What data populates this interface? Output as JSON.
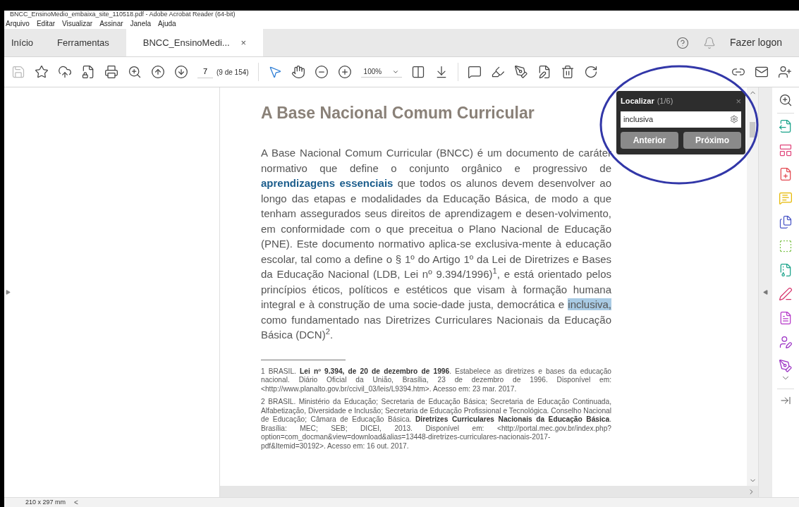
{
  "window": {
    "title": "BNCC_EnsinoMedio_embaixa_site_110518.pdf - Adobe Acrobat Reader (64-bit)"
  },
  "menu": [
    "Arquivo",
    "Editar",
    "Visualizar",
    "Assinar",
    "Janela",
    "Ajuda"
  ],
  "tabs": [
    {
      "label": "Início",
      "selected": false
    },
    {
      "label": "Ferramentas",
      "selected": false
    },
    {
      "label": "BNCC_EnsinoMedi...",
      "selected": true,
      "close": "×"
    }
  ],
  "account": {
    "label": "Fazer logon"
  },
  "toolbar": {
    "save": {
      "disabled": true
    },
    "page": {
      "value": "7",
      "total": "(9 de 154)"
    },
    "tools": [
      {
        "kind": "select",
        "selected": true
      },
      {
        "kind": "hand",
        "selected": false
      }
    ],
    "zoom": {
      "value": "100%"
    }
  },
  "document": {
    "title": "A Base Nacional Comum Curricular",
    "body": [
      {
        "kind": "text",
        "text": "A Base Nacional Comum Curricular (BNCC) é um documento de caráter normativo que define o conjunto orgânico e progressivo de "
      },
      {
        "kind": "strong",
        "text": "aprendizagens essenciais"
      },
      {
        "kind": "text",
        "text": " que todos os alunos devem desenvolver ao longo das etapas e modalidades da Educação Básica, de modo a que tenham assegurados seus direitos de aprendizagem e desen-volvimento, em conformidade com o que preceitua o Plano Nacional de Educação (PNE). Este documento normativo aplica-se exclusiva-mente à educação escolar, tal como a define o § 1º do Artigo 1º da Lei de Diretrizes e Bases da Educação Nacional (LDB, Lei nº 9.394/1996)$^{1}$, e está orientado pelos princípios éticos, políticos e estéticos que visam à formação humana integral e à construção de uma socie-dade justa, democrática e "
      },
      {
        "kind": "match",
        "text": "inclusiva,"
      },
      {
        "kind": "text",
        "text": " como fundamentado nas Diretrizes Curriculares Nacionais da Educação Básica (DCN)$^{2}$."
      }
    ],
    "footnotes": [
      "1   BRASIL. **Lei nº 9.394, de 20 de dezembro de 1996**. Estabelece as diretrizes e bases da educação nacional. Diário Oficial da União, Brasília, 23 de dezembro de 1996. Disponível em: <http://www.planalto.gov.br/ccivil_03/leis/L9394.htm>. Acesso em: 23 mar. 2017.",
      "2   BRASIL. Ministério da Educação; Secretaria de Educação Básica; Secretaria de Educação Continuada, Alfabetização, Diversidade e Inclusão; Secretaria de Educação Profissional e Tecnológica. Conselho Nacional de Educação; Câmara de Educação Básica. **Diretrizes Curriculares Nacionais da Educação Básica**. Brasília: MEC; SEB; DICEI, 2013. Disponível em: <http://portal.mec.gov.br/index.php?option=com_docman&view=download&alias=13448-diretrizes-curriculares-nacionais-2017-pdf&Itemid=30192>. Acesso em: 16 out. 2017."
    ]
  },
  "find": {
    "title": "Localizar",
    "count": "(1/6)",
    "close": "×",
    "value": "inclusiva",
    "buttons": [
      "Anterior",
      "Próximo"
    ]
  },
  "status_bar": {
    "size": "210 x 297 mm",
    "arrow": "<"
  }
}
